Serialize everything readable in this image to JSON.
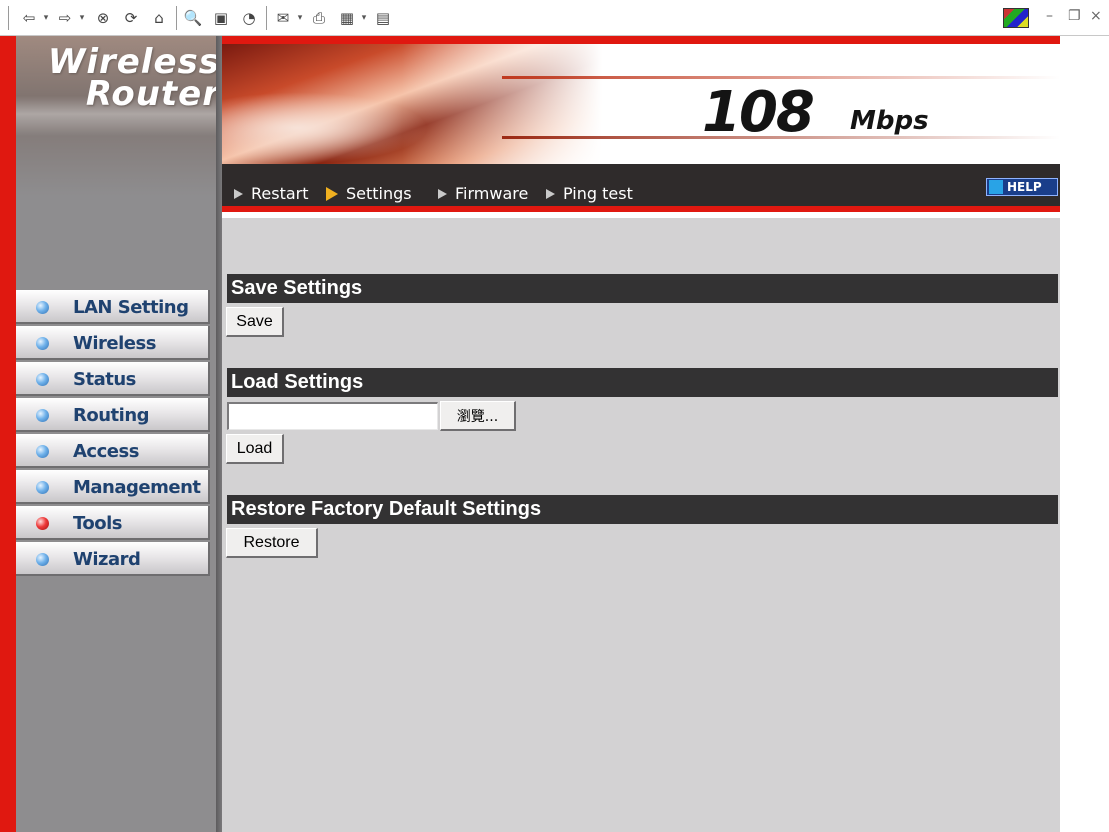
{
  "toolbar": {
    "icons": [
      "back-icon",
      "forward-icon",
      "stop-icon",
      "refresh-icon",
      "home-icon",
      "search-icon",
      "favorites-icon",
      "history-icon",
      "mail-icon",
      "print-icon",
      "edit-icon",
      "discuss-icon"
    ],
    "glyphs": {
      "back": "⇦",
      "forward": "⇨",
      "stop": "⊗",
      "refresh": "⟳",
      "home": "⌂",
      "search": "🔍",
      "favorites": "▣",
      "history": "◔",
      "mail": "✉",
      "print": "⎙",
      "edit": "▦",
      "discuss": "▤",
      "drop": "▾",
      "minimize": "–",
      "restore": "❐",
      "close": "×"
    }
  },
  "sidebar": {
    "logo_line1": "Wireless",
    "logo_line2": "Router",
    "items": [
      {
        "label": "LAN Setting",
        "dot": "blue"
      },
      {
        "label": "Wireless",
        "dot": "blue"
      },
      {
        "label": "Status",
        "dot": "blue"
      },
      {
        "label": "Routing",
        "dot": "blue"
      },
      {
        "label": "Access",
        "dot": "blue"
      },
      {
        "label": "Management",
        "dot": "blue"
      },
      {
        "label": "Tools",
        "dot": "red",
        "active": true
      },
      {
        "label": "Wizard",
        "dot": "blue"
      }
    ]
  },
  "banner": {
    "speed": "108",
    "unit": "Mbps"
  },
  "nav": {
    "items": [
      "Restart",
      "Settings",
      "Firmware",
      "Ping test"
    ],
    "active": "Settings",
    "help": "HELP"
  },
  "content": {
    "save_title": "Save Settings",
    "save_button": "Save",
    "load_title": "Load Settings",
    "file_value": "",
    "browse_button": "瀏覽...",
    "load_button": "Load",
    "restore_title": "Restore Factory Default Settings",
    "restore_button": "Restore"
  },
  "colors": {
    "red": "#e01810",
    "dark_bar": "#333233",
    "content_bg": "#d3d2d3",
    "sidebar_bg": "#8e8d8f",
    "menu_text": "#1f4270"
  }
}
